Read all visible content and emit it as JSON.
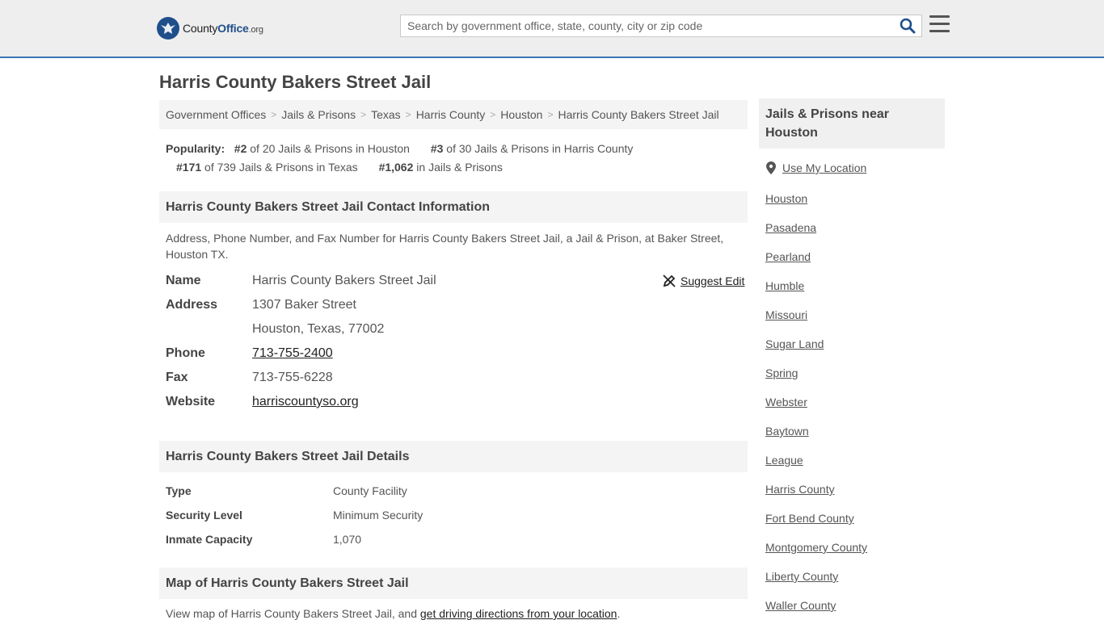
{
  "header": {
    "logo_main": "County",
    "logo_brand": "Office",
    "logo_tld": ".org",
    "search_placeholder": "Search by government office, state, county, city or zip code",
    "search_icon": "search-icon",
    "menu_icon": "hamburger-menu-icon"
  },
  "page": {
    "title": "Harris County Bakers Street Jail"
  },
  "breadcrumb": [
    "Government Offices",
    "Jails & Prisons",
    "Texas",
    "Harris County",
    "Houston",
    "Harris County Bakers Street Jail"
  ],
  "popularity": {
    "label": "Popularity:",
    "items": [
      {
        "rank": "#2",
        "text": "of 20 Jails & Prisons in Houston"
      },
      {
        "rank": "#3",
        "text": "of 30 Jails & Prisons in Harris County"
      },
      {
        "rank": "#171",
        "text": "of 739 Jails & Prisons in Texas"
      },
      {
        "rank": "#1,062",
        "text": "in Jails & Prisons"
      }
    ]
  },
  "contact": {
    "heading": "Harris County Bakers Street Jail Contact Information",
    "description": "Address, Phone Number, and Fax Number for Harris County Bakers Street Jail, a Jail & Prison, at Baker Street, Houston TX.",
    "suggest_edit": "Suggest Edit",
    "name_label": "Name",
    "name": "Harris County Bakers Street Jail",
    "address_label": "Address",
    "address_line1": "1307 Baker Street",
    "address_line2": "Houston, Texas, 77002",
    "phone_label": "Phone",
    "phone": "713-755-2400",
    "fax_label": "Fax",
    "fax": "713-755-6228",
    "website_label": "Website",
    "website": "harriscountyso.org"
  },
  "details": {
    "heading": "Harris County Bakers Street Jail Details",
    "rows": [
      {
        "label": "Type",
        "value": "County Facility"
      },
      {
        "label": "Security Level",
        "value": "Minimum Security"
      },
      {
        "label": "Inmate Capacity",
        "value": "1,070"
      }
    ]
  },
  "map": {
    "heading": "Map of Harris County Bakers Street Jail",
    "text_before": "View map of Harris County Bakers Street Jail, and ",
    "link": "get driving directions from your location",
    "text_after": "."
  },
  "sidebar": {
    "heading": "Jails & Prisons near Houston",
    "use_location": "Use My Location",
    "links": [
      "Houston",
      "Pasadena",
      "Pearland",
      "Humble",
      "Missouri",
      "Sugar Land",
      "Spring",
      "Webster",
      "Baytown",
      "League",
      "Harris County",
      "Fort Bend County",
      "Montgomery County",
      "Liberty County",
      "Waller County"
    ]
  }
}
